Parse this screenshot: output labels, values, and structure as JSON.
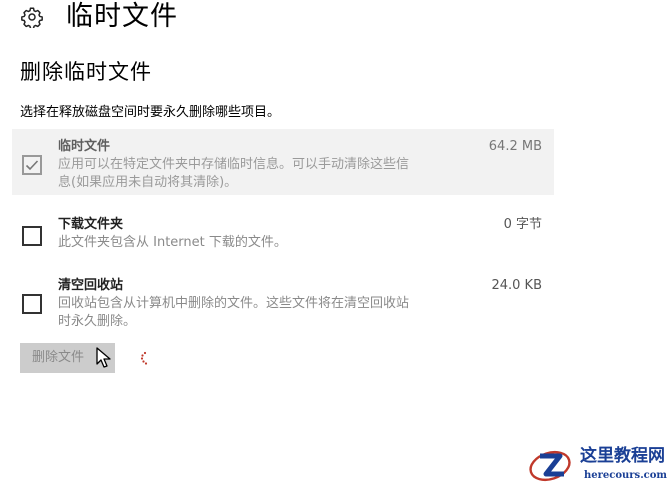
{
  "header": {
    "icon": "gear-icon",
    "title": "临时文件"
  },
  "section": {
    "title": "删除临时文件",
    "description": "选择在释放磁盘空间时要永久删除哪些项目。"
  },
  "items": [
    {
      "name": "临时文件",
      "size": "64.2 MB",
      "desc_line1": "应用可以在特定文件夹中存储临时信息。可以手动清除这些信",
      "desc_line2": "息(如果应用未自动将其清除)。",
      "checked": true
    },
    {
      "name": "下载文件夹",
      "size": "0 字节",
      "desc_line1": "此文件夹包含从 Internet 下载的文件。",
      "checked": false
    },
    {
      "name": "清空回收站",
      "size": "24.0 KB",
      "desc_line1": "回收站包含从计算机中删除的文件。这些文件将在清空回收站",
      "desc_line2": "时永久删除。",
      "checked": false
    }
  ],
  "actions": {
    "delete_label": "删除文件",
    "delete_disabled": true
  },
  "watermark": {
    "title": "这里教程网",
    "domain": "herecours.com"
  },
  "colors": {
    "highlight_bg": "#f2f2f2",
    "button_bg": "#cccccc",
    "spinner": "#c0392b",
    "watermark": "#1a3f95"
  }
}
